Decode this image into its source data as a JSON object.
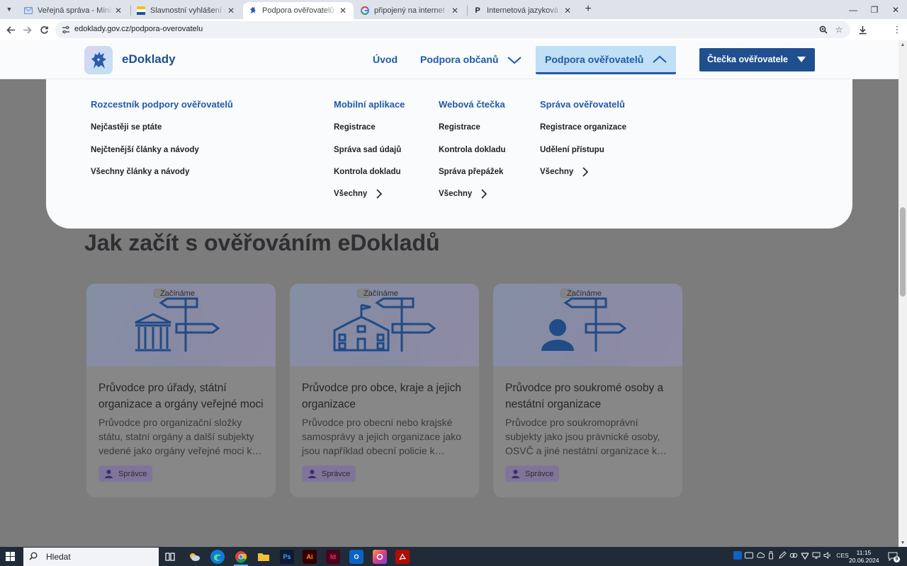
{
  "browser": {
    "tabs": [
      {
        "title": "Veřejná správa - Ministerstvo vnitra",
        "active": false,
        "favicon": "envelope-icon"
      },
      {
        "title": "Slavnostní vyhlášení výsledků soutěže",
        "active": false,
        "favicon": "flag-icon"
      },
      {
        "title": "Podpora ověřovatelů | eDoklady",
        "active": true,
        "favicon": "lion-icon"
      },
      {
        "title": "připojený na internet - Hledat Googlem",
        "active": false,
        "favicon": "google-icon"
      },
      {
        "title": "Internetová jazyková příručka - Ústav pro jazyk český",
        "active": false,
        "favicon": "p-icon"
      }
    ],
    "url": "edoklady.gov.cz/podpora-overovatelu"
  },
  "header": {
    "brand": "eDoklady",
    "nav": {
      "uvod": "Úvod",
      "podpora_obcanu": "Podpora občanů",
      "podpora_overovatelu": "Podpora ověřovatelů"
    },
    "reader_button": "Čtečka ověřovatele"
  },
  "mega_menu": {
    "columns": [
      {
        "heading": "Rozcestník podpory ověřovatelů",
        "items": [
          "Nejčastěji se ptáte",
          "Nejčtenější články a návody",
          "Všechny články a návody"
        ],
        "more": null
      },
      {
        "heading": "Mobilní aplikace",
        "items": [
          "Registrace",
          "Správa sad údajů",
          "Kontrola dokladu"
        ],
        "more": "Všechny"
      },
      {
        "heading": "Webová čtečka",
        "items": [
          "Registrace",
          "Kontrola dokladu",
          "Správa přepážek"
        ],
        "more": "Všechny"
      },
      {
        "heading": "Správa ověřovatelů",
        "items": [
          "Registrace organizace",
          "Udělení přístupu"
        ],
        "more": "Všechny"
      }
    ]
  },
  "main": {
    "heading": "Jak začít s ověřováním eDokladů",
    "cards": [
      {
        "title": "Průvodce pro úřady, státní organizace a orgány veřejné moci",
        "description": "Průvodce pro organizační složky státu, statní orgány a další subjekty vedené jako orgány veřejné moci k…",
        "icon": "government-building-signpost-icon",
        "tags": {
          "role": "Správce",
          "start": "Začínáme"
        }
      },
      {
        "title": "Průvodce pro obce, kraje a jejich organizace",
        "description": "Průvodce pro obecní nebo krajské samosprávy a jejich organizace jako jsou například obecní policie k…",
        "icon": "town-hall-signpost-icon",
        "tags": {
          "role": "Správce",
          "start": "Začínáme"
        }
      },
      {
        "title": "Průvodce pro soukromé osoby a nestátní organizace",
        "description": "Průvodce pro soukromoprávní subjekty jako jsou právnické osoby, OSVČ a jiné nestátní organizace k…",
        "icon": "person-signpost-icon",
        "tags": {
          "role": "Správce",
          "start": "Začínáme"
        }
      }
    ]
  },
  "taskbar": {
    "search_placeholder": "Hledat",
    "language": "CES",
    "time": "11:15",
    "date": "20.06.2024",
    "notifications": "9"
  },
  "colors": {
    "brand_blue": "#1f5aa8",
    "button_blue": "#1f4f8f",
    "active_nav_bg": "#bfe0f6",
    "overlay_gray": "#7c7c7c"
  }
}
